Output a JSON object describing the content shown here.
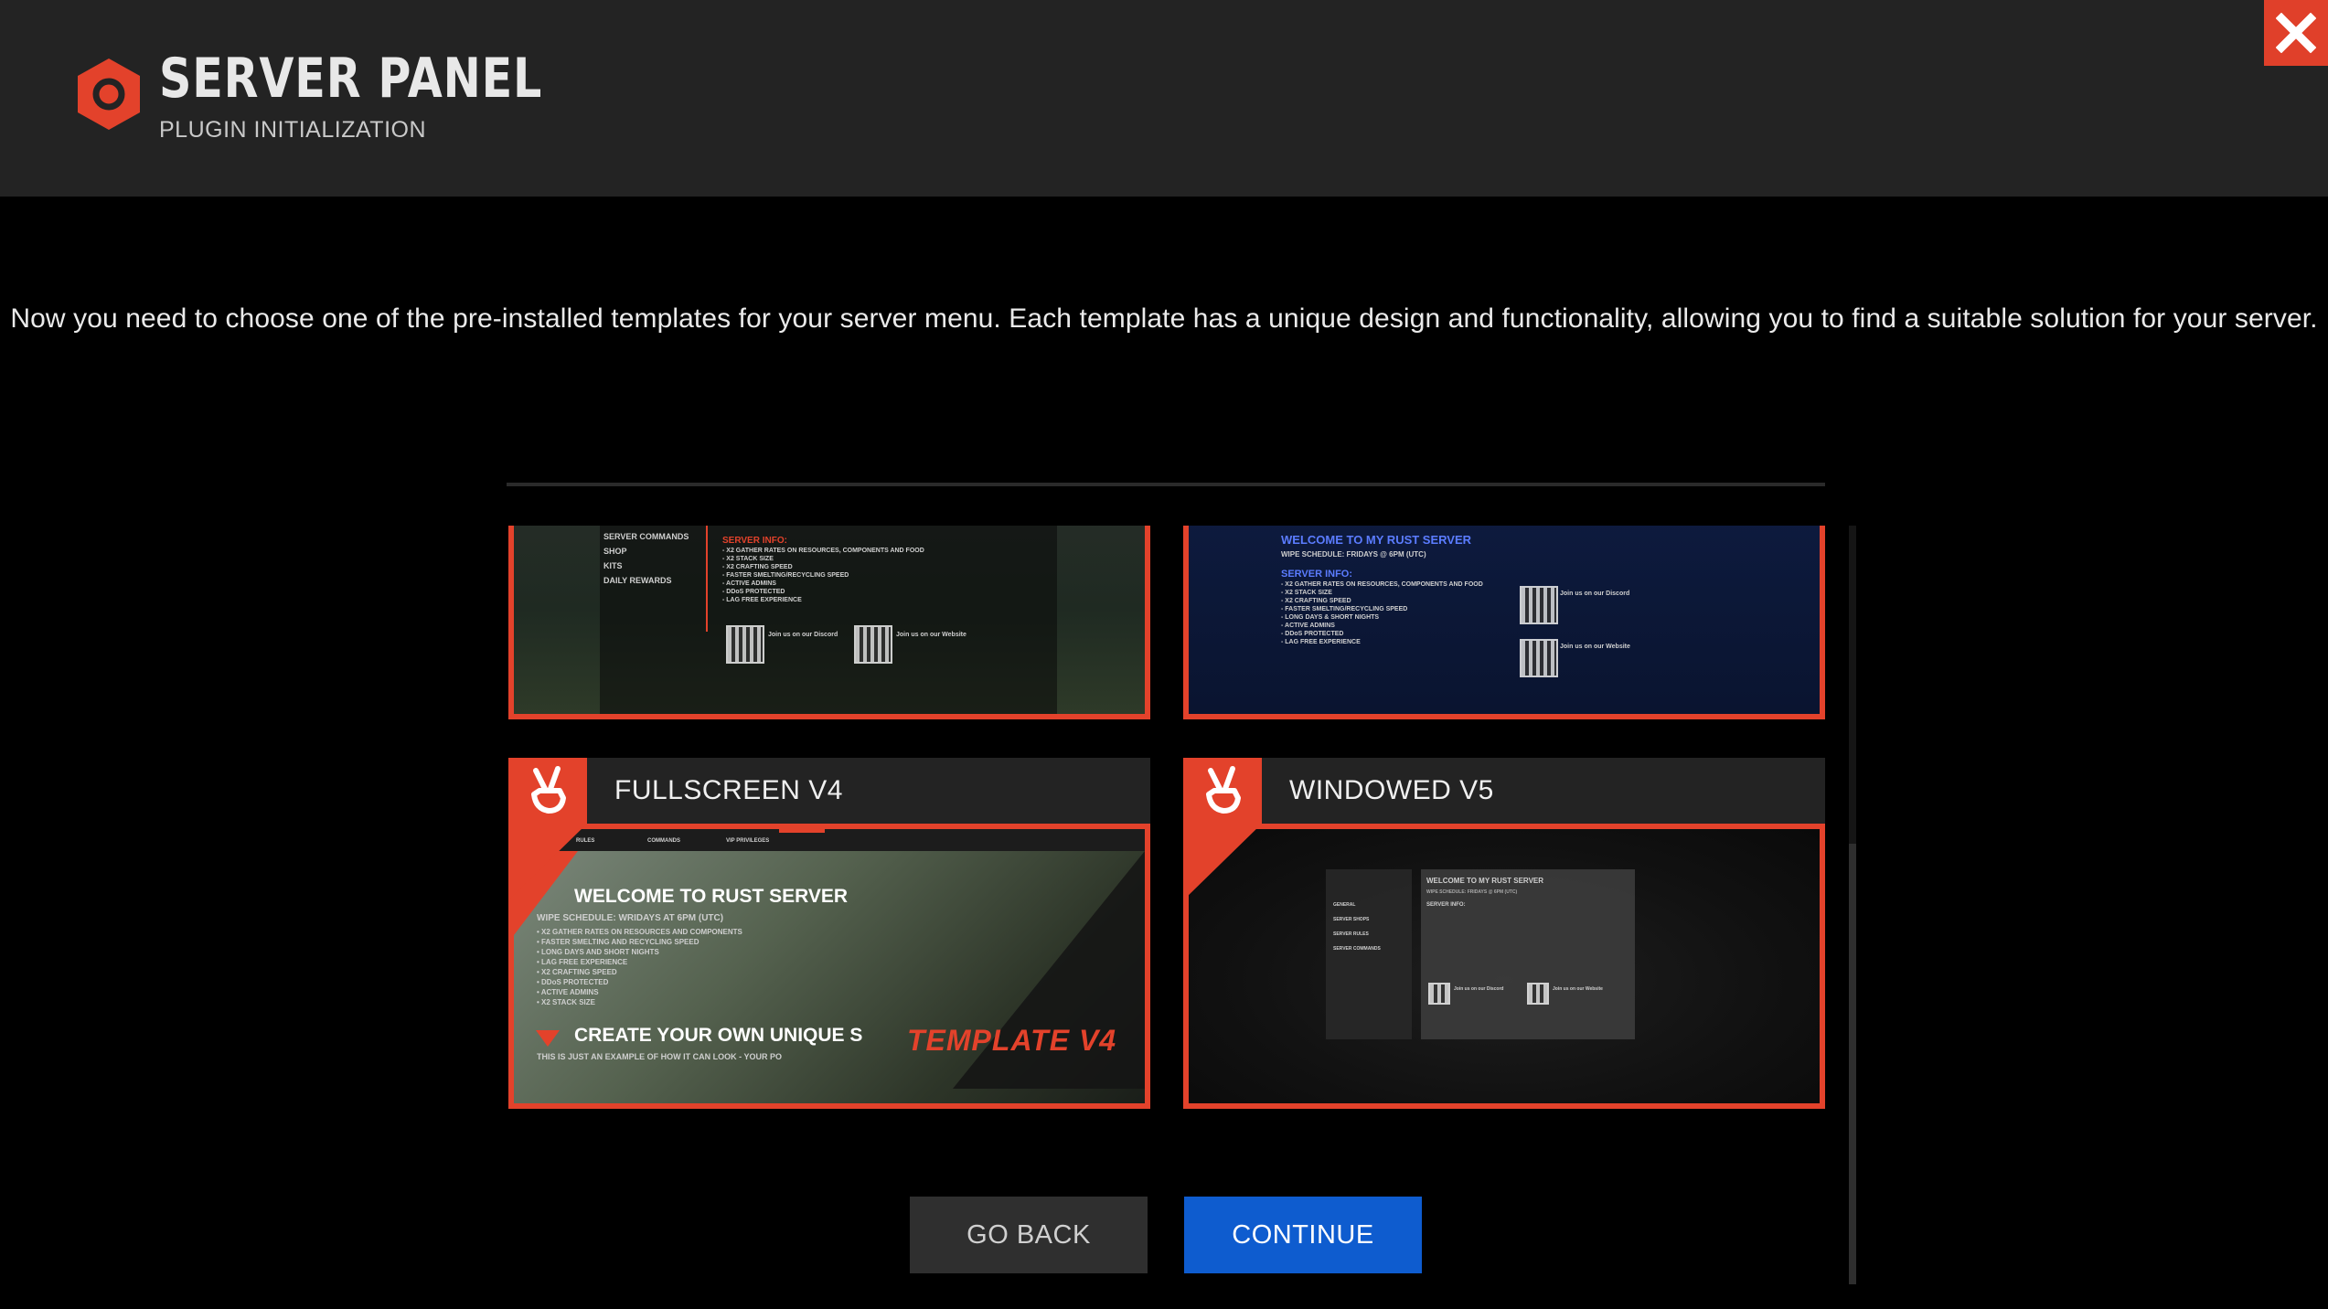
{
  "header": {
    "title": "SERVER PANEL",
    "subtitle": "PLUGIN INITIALIZATION",
    "logo_icon": "hexagon-ring-logo",
    "close_icon": "close-x-icon"
  },
  "colors": {
    "accent": "#e3422b",
    "header_bg": "#232323",
    "background": "#000000",
    "continue_bg": "#0e5ccf",
    "back_bg": "#2f2f2f"
  },
  "instructions": "Now you need to choose one of the pre-installed templates for your server menu. Each template has a unique design and functionality, allowing you to find a suitable solution for your server.",
  "templates": [
    {
      "label": "",
      "preview": {
        "menu": [
          "SERVER COMMANDS",
          "SHOP",
          "KITS",
          "DAILY REWARDS"
        ],
        "info_title": "SERVER INFO:",
        "info_lines": [
          "- X2 GATHER RATES ON RESOURCES, COMPONENTS AND FOOD",
          "- X2 STACK SIZE",
          "- X2 CRAFTING SPEED",
          "- FASTER SMELTING/RECYCLING SPEED",
          "- ACTIVE ADMINS",
          "- DDoS PROTECTED",
          "- LAG FREE EXPERIENCE"
        ],
        "discord": "Join us on our Discord",
        "website": "Join us on our Website"
      }
    },
    {
      "label": "",
      "preview": {
        "welcome": "WELCOME TO MY RUST SERVER",
        "wipe": "WIPE SCHEDULE: FRIDAYS @ 6PM (UTC)",
        "info_title": "SERVER INFO:",
        "info_lines": [
          "- X2 GATHER RATES ON RESOURCES, COMPONENTS AND FOOD",
          "- X2 STACK SIZE",
          "- X2 CRAFTING SPEED",
          "- FASTER SMELTING/RECYCLING SPEED",
          "- LONG DAYS & SHORT NIGHTS",
          "- ACTIVE ADMINS",
          "- DDoS PROTECTED",
          "- LAG FREE EXPERIENCE"
        ],
        "discord": "Join us on our Discord",
        "website": "Join us on our Website"
      }
    },
    {
      "label": "FULLSCREEN V4",
      "badge_icon": "peace-hand-icon",
      "preview": {
        "tabs": [
          "RULES",
          "COMMANDS",
          "VIP PRIVILEGES"
        ],
        "welcome": "WELCOME TO RUST SERVER",
        "wipe": "WIPE SCHEDULE: WRIDAYS AT 6PM (UTC)",
        "info_lines": [
          "• X2 GATHER RATES ON RESOURCES AND COMPONENTS",
          "• FASTER SMELTING AND RECYCLING SPEED",
          "• LONG DAYS AND SHORT NIGHTS",
          "• LAG FREE EXPERIENCE",
          "• X2 CRAFTING SPEED",
          "• DDoS PROTECTED",
          "• ACTIVE ADMINS",
          "• X2 STACK SIZE"
        ],
        "create": "CREATE YOUR OWN UNIQUE S",
        "example": "THIS IS JUST AN EXAMPLE OF HOW IT CAN LOOK - YOUR PO",
        "watermark": "TEMPLATE V4"
      }
    },
    {
      "label": "WINDOWED V5",
      "badge_icon": "peace-hand-icon",
      "preview": {
        "menu": [
          "GENERAL",
          "SERVER SHOPS",
          "SERVER RULES",
          "SERVER COMMANDS"
        ],
        "welcome": "WELCOME TO MY RUST SERVER",
        "wipe": "WIPE SCHEDULE: FRIDAYS @ 6PM (UTC)",
        "info_title": "SERVER INFO:",
        "discord": "Join us on our Discord",
        "website": "Join us on our Website"
      }
    }
  ],
  "buttons": {
    "back": "GO BACK",
    "continue": "CONTINUE"
  }
}
